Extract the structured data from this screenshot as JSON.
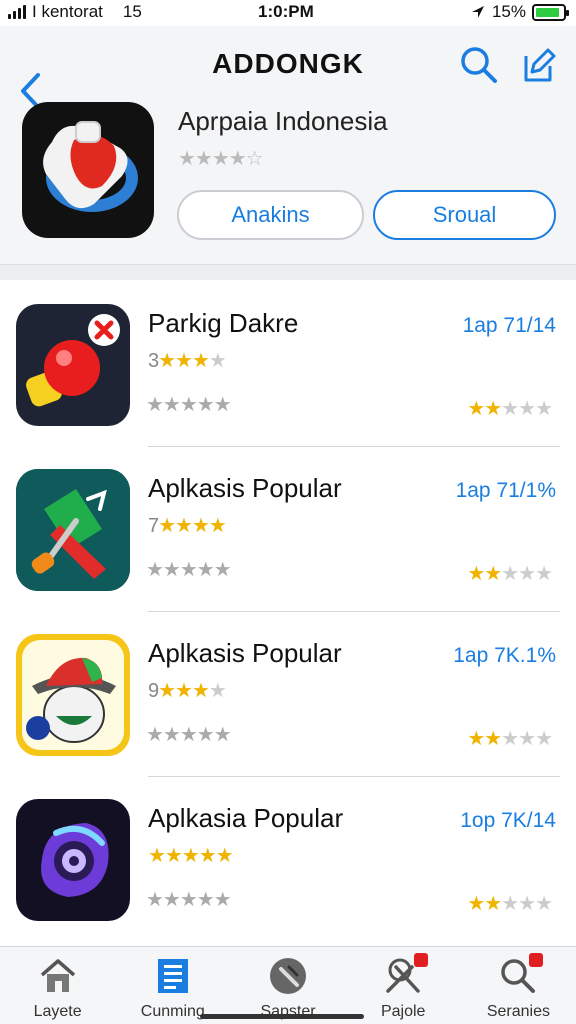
{
  "status_bar": {
    "carrier": "I kentorat",
    "network": "15",
    "time": "1:0:PM",
    "battery": "15%",
    "battery_level": 0.9
  },
  "header": {
    "title": "ADDONGK",
    "app_name": "Aprpaia Indonesia",
    "stars": "★★★★☆",
    "button_primary": "Anakins",
    "button_secondary": "Sroual"
  },
  "list": [
    {
      "name": "Parkig Dakre",
      "rating_number": "3",
      "rating_stars": "★★★",
      "rating_empty": "★",
      "sub_stars": "★★★★★",
      "version": "1ap 71/14",
      "right_gold": "★★",
      "right_empty": "★★★"
    },
    {
      "name": "Aplkasis Popular",
      "rating_number": "7",
      "rating_stars": "★★★★",
      "rating_empty": "",
      "sub_stars": "★★★★★",
      "version": "1ap 71/1%",
      "right_gold": "★★",
      "right_empty": "★★★"
    },
    {
      "name": "Aplkasis Popular",
      "rating_number": "9",
      "rating_stars": "★★★",
      "rating_empty": "★",
      "sub_stars": "★★★★★",
      "version": "1ap 7K.1%",
      "right_gold": "★★",
      "right_empty": "★★★"
    },
    {
      "name": "Aplkasia Popular",
      "rating_number": "",
      "rating_stars": "★★★★★",
      "rating_empty": "",
      "sub_stars": "★★★★★",
      "version": "1op 7K/14",
      "right_gold": "★★",
      "right_empty": "★★★"
    }
  ],
  "tabs": [
    {
      "label": "Layete",
      "icon": "house-icon"
    },
    {
      "label": "Cunming",
      "icon": "list-icon"
    },
    {
      "label": "Sapster",
      "icon": "compass-icon"
    },
    {
      "label": "Pajole",
      "icon": "pin-tools-icon"
    },
    {
      "label": "Seranies",
      "icon": "search-icon"
    }
  ],
  "colors": {
    "accent": "#1a7de0",
    "star_gold": "#f0b400",
    "badge_red": "#e02020"
  }
}
